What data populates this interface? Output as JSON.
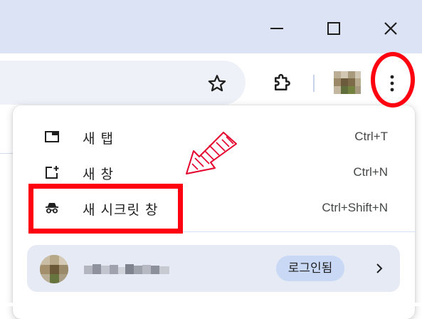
{
  "window": {
    "minimize_icon": "minimize-icon",
    "maximize_icon": "maximize-icon",
    "close_icon": "close-icon"
  },
  "toolbar": {
    "bookmark_icon": "star-icon",
    "extensions_icon": "puzzle-icon",
    "menu_icon": "three-dots-vertical-icon"
  },
  "menu": {
    "items": [
      {
        "label": "새 탭",
        "shortcut": "Ctrl+T",
        "icon": "new-tab-icon"
      },
      {
        "label": "새 창",
        "shortcut": "Ctrl+N",
        "icon": "new-window-icon"
      },
      {
        "label": "새 시크릿 창",
        "shortcut": "Ctrl+Shift+N",
        "icon": "incognito-icon"
      }
    ],
    "profile": {
      "status": "로그인됨",
      "chevron_icon": "chevron-right-icon"
    }
  },
  "annotations": {
    "color": "#ff0010"
  }
}
